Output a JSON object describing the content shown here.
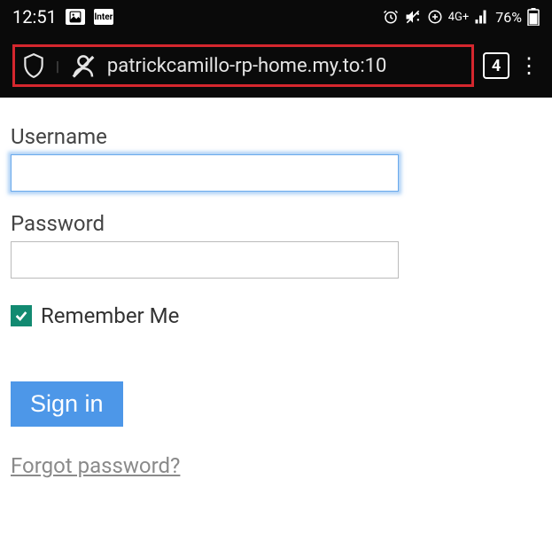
{
  "status_bar": {
    "time": "12:51",
    "app_badge": "Inter",
    "network_label": "4G+",
    "battery_text": "76%"
  },
  "browser": {
    "url": "patrickcamillo-rp-home.my.to:10",
    "tab_count": "4"
  },
  "form": {
    "username_label": "Username",
    "username_value": "",
    "password_label": "Password",
    "password_value": "",
    "remember_label": "Remember Me",
    "remember_checked": true,
    "signin_label": "Sign in",
    "forgot_label": "Forgot password?"
  },
  "icons": {
    "shield": "shield-icon",
    "user_slash": "user-slash-icon",
    "alarm": "⏰",
    "vibrate": "📳",
    "signal": "📶",
    "battery": "🔋",
    "menu": "⋮"
  }
}
